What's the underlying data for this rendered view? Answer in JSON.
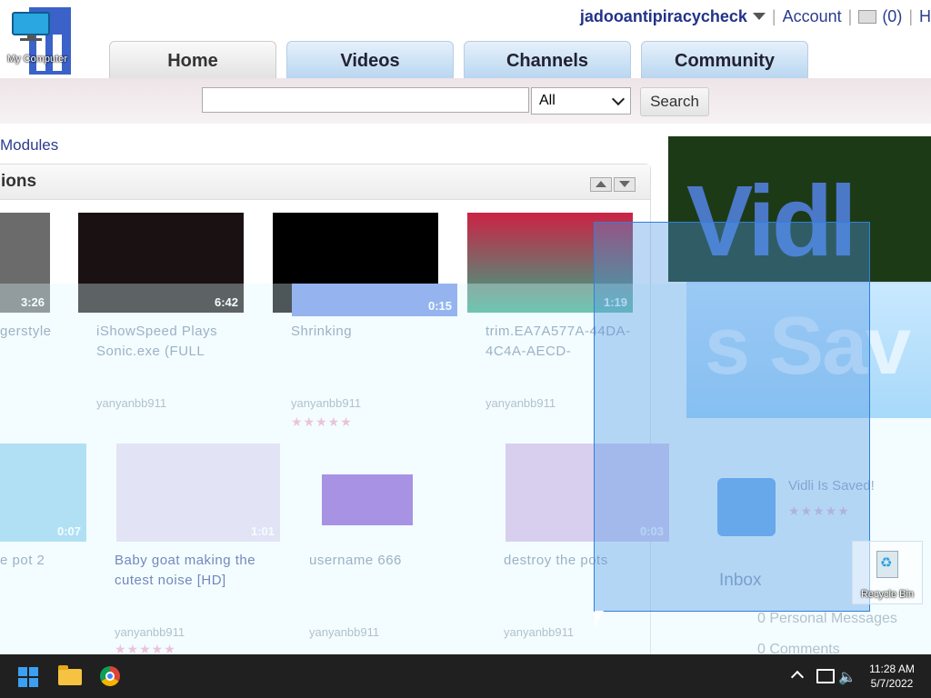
{
  "user": {
    "name": "jadooantipiracycheck",
    "account_label": "Account",
    "inbox_count": "(0)",
    "extra": "H"
  },
  "desktop": {
    "my_computer_label": "My Computer",
    "recycle_bin_label": "Recycle Bin"
  },
  "nav": {
    "tabs": [
      {
        "label": "Home"
      },
      {
        "label": "Videos"
      },
      {
        "label": "Channels"
      },
      {
        "label": "Community"
      }
    ]
  },
  "search": {
    "value": "",
    "scope": "All",
    "button_label": "Search"
  },
  "modules_link": "Modules",
  "panel": {
    "title": "ions"
  },
  "videos_row1": [
    {
      "title": "gerstyle",
      "user": "",
      "duration": "3:26"
    },
    {
      "title": "iShowSpeed Plays Sonic.exe (FULL",
      "user": "yanyanbb911",
      "duration": "6:42"
    },
    {
      "title": "Shrinking",
      "user": "yanyanbb911",
      "duration": "0:15"
    },
    {
      "title": "trim.EA7A577A-44DA-4C4A-AECD-",
      "user": "yanyanbb911",
      "duration": "1:19"
    }
  ],
  "videos_row2": [
    {
      "title": "e pot 2",
      "user": "",
      "duration": "0:07"
    },
    {
      "title": "Baby goat making the cutest noise [HD]",
      "user": "yanyanbb911",
      "duration": "1:01"
    },
    {
      "title": "username 666",
      "user": "yanyanbb911",
      "duration": ""
    },
    {
      "title": "destroy the pots",
      "user": "yanyanbb911",
      "duration": "0:03"
    }
  ],
  "side": {
    "promo_text": "Vidl",
    "promo_text_2": "s Sav",
    "featured_title": "Vidli Is Saved!",
    "inbox_heading": "Inbox",
    "inbox_messages": "0 Personal Messages",
    "inbox_comments": "0 Comments"
  },
  "taskbar": {
    "time": "11:28 AM",
    "date": "5/7/2022"
  },
  "colors": {
    "link": "#2a3d8f",
    "tab_blue": "#b9d6f0",
    "taskbar": "#202020",
    "selection": "#2f7fe0"
  }
}
